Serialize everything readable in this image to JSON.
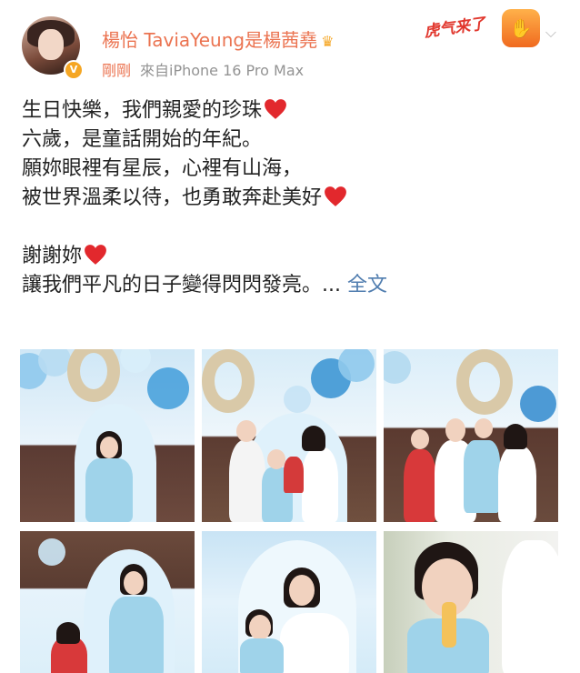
{
  "header": {
    "name": "楊怡 TaviaYeung是楊茜堯",
    "time": "剛剛",
    "source": "來自iPhone 16 Pro Max",
    "badge_text": "虎气来了"
  },
  "post": {
    "lines": [
      "生日快樂，我們親愛的珍珠",
      "六歲，是童話開始的年紀。",
      "願妳眼裡有星辰，心裡有山海，",
      "被世界溫柔以待，也勇敢奔赴美好",
      "謝謝妳",
      "讓我們平凡的日子變得閃閃發亮。..."
    ],
    "more_label": "全文"
  },
  "colors": {
    "name": "#eb7350",
    "link": "#507daf",
    "heart": "#e2282d",
    "meta": "#939393"
  },
  "photos": [
    {
      "label": "photo-1"
    },
    {
      "label": "photo-2"
    },
    {
      "label": "photo-3"
    },
    {
      "label": "photo-4"
    },
    {
      "label": "photo-5"
    },
    {
      "label": "photo-6"
    }
  ]
}
